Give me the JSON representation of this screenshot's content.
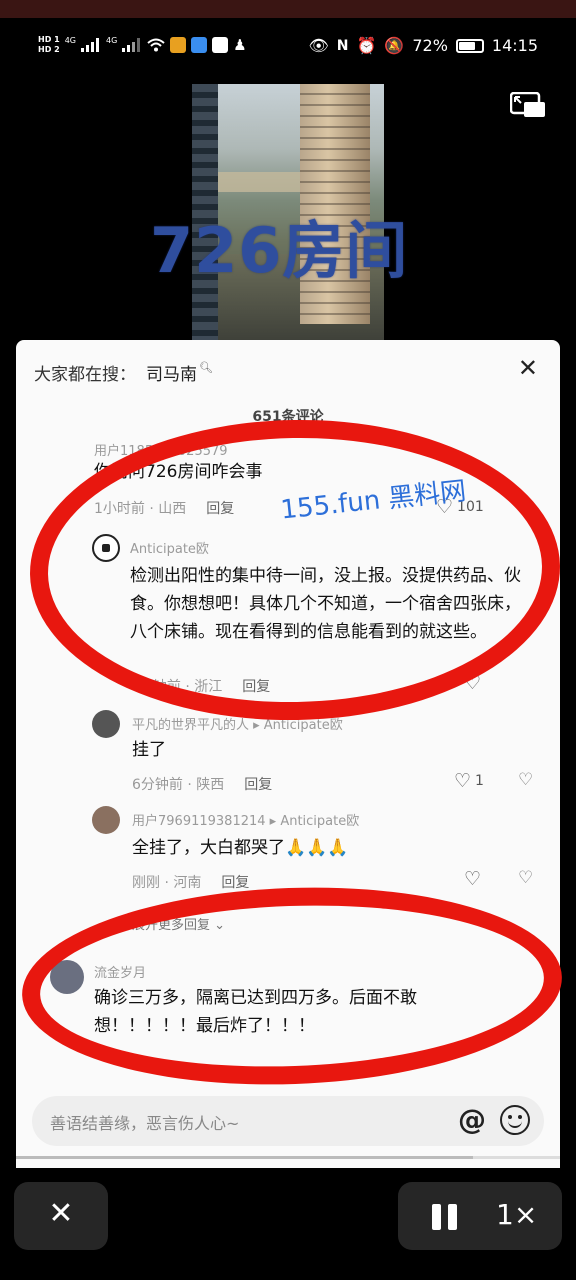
{
  "status_bar": {
    "network_left": [
      "HD 1",
      "HD 2"
    ],
    "net_gen_1": "4G",
    "net_gen_2": "4G",
    "battery": "72%",
    "time": "14:15"
  },
  "video": {
    "overlay_title": "726房间"
  },
  "sheet": {
    "search_prefix": "大家都在搜：",
    "search_keyword": "司马南",
    "comment_count": "651条评论",
    "watermark": "155.fun 黑料网"
  },
  "comments": [
    {
      "user": "用户1185015025579",
      "text": "你问问726房间咋会事",
      "time_loc": "1小时前 · 山西",
      "reply": "回复",
      "likes": "101"
    },
    {
      "user": "Anticipate欧",
      "text": "检测出阳性的集中待一间，没上报。没提供药品、伙食。你想想吧！具体几个不知道，一个宿舍四张床，八个床铺。现在看得到的信息能看到的就这些。",
      "time_loc": "4分钟前 · 浙江",
      "reply": "回复",
      "likes": ""
    },
    {
      "user": "平凡的世界平凡的人 ▸ Anticipate欧",
      "text": "挂了",
      "time_loc": "6分钟前 · 陕西",
      "reply": "回复",
      "likes": "1"
    },
    {
      "user": "用户7969119381214 ▸ Anticipate欧",
      "text": "全挂了，大白都哭了🙏🙏🙏",
      "time_loc": "刚刚 · 河南",
      "reply": "回复",
      "likes": ""
    },
    {
      "user": "流金岁月",
      "text": "确诊三万多，隔离已达到四万多。后面不敢想！！！！！最后炸了！！！",
      "time_loc": "",
      "reply": "",
      "likes": ""
    }
  ],
  "expand_replies": "展开更多回复 ⌄",
  "input": {
    "placeholder": "善语结善缘，恶言伤人心~",
    "at_symbol": "@"
  },
  "player_controls": {
    "close": "✕",
    "speed": "1×"
  },
  "progress_fraction": 0.84
}
